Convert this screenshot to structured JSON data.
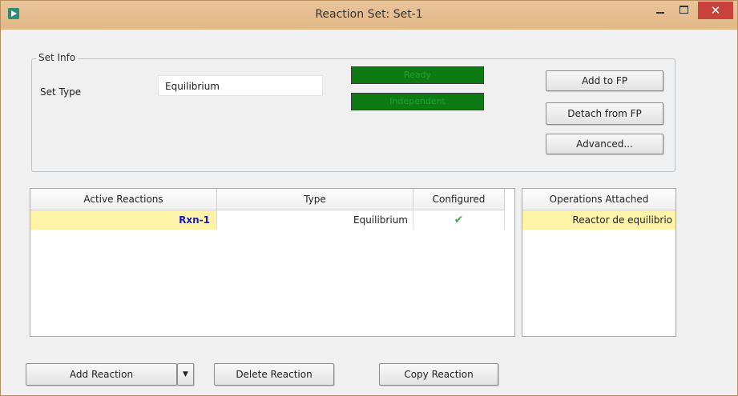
{
  "window": {
    "title": "Reaction Set: Set-1",
    "close_glyph": "✕"
  },
  "set_info": {
    "legend": "Set Info",
    "set_type_label": "Set Type",
    "set_type_value": "Equilibrium",
    "status_ready": "Ready",
    "status_independent": "Independent",
    "status_color": "#0d7a12"
  },
  "buttons": {
    "add_to_fp": "Add to FP",
    "detach_from_fp": "Detach from FP",
    "advanced": "Advanced...",
    "add_reaction": "Add Reaction",
    "add_reaction_dropdown": "▼",
    "delete_reaction": "Delete Reaction",
    "copy_reaction": "Copy Reaction"
  },
  "reactions_table": {
    "columns": [
      "Active Reactions",
      "Type",
      "Configured"
    ],
    "rows": [
      {
        "name": "Rxn-1",
        "type": "Equilibrium",
        "configured": "✔"
      }
    ]
  },
  "operations_table": {
    "header": "Operations Attached",
    "rows": [
      "Reactor de equilibrio"
    ]
  },
  "icons": {
    "app": "app-icon",
    "minimize": "minimize-icon",
    "maximize": "maximize-icon",
    "close": "close-icon",
    "check": "check-icon",
    "dropdown": "chevron-down-icon"
  }
}
